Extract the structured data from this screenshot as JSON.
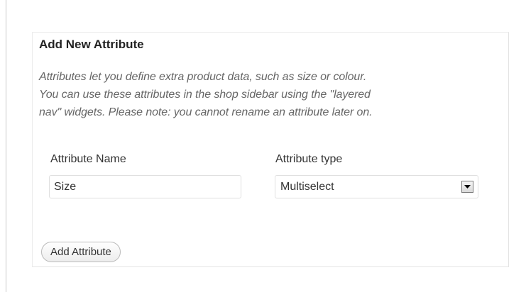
{
  "form": {
    "title": "Add New Attribute",
    "description_lines": [
      "Attributes let you define extra product data, such as size or colour.",
      "You can use these attributes in the shop sidebar using the \"layered",
      "nav\" widgets. Please note: you cannot rename an attribute later on."
    ],
    "name_field": {
      "label": "Attribute Name",
      "value": "Size"
    },
    "type_field": {
      "label": "Attribute type",
      "selected": "Multiselect",
      "icon": "chevron-down-icon"
    },
    "submit_label": "Add Attribute"
  }
}
